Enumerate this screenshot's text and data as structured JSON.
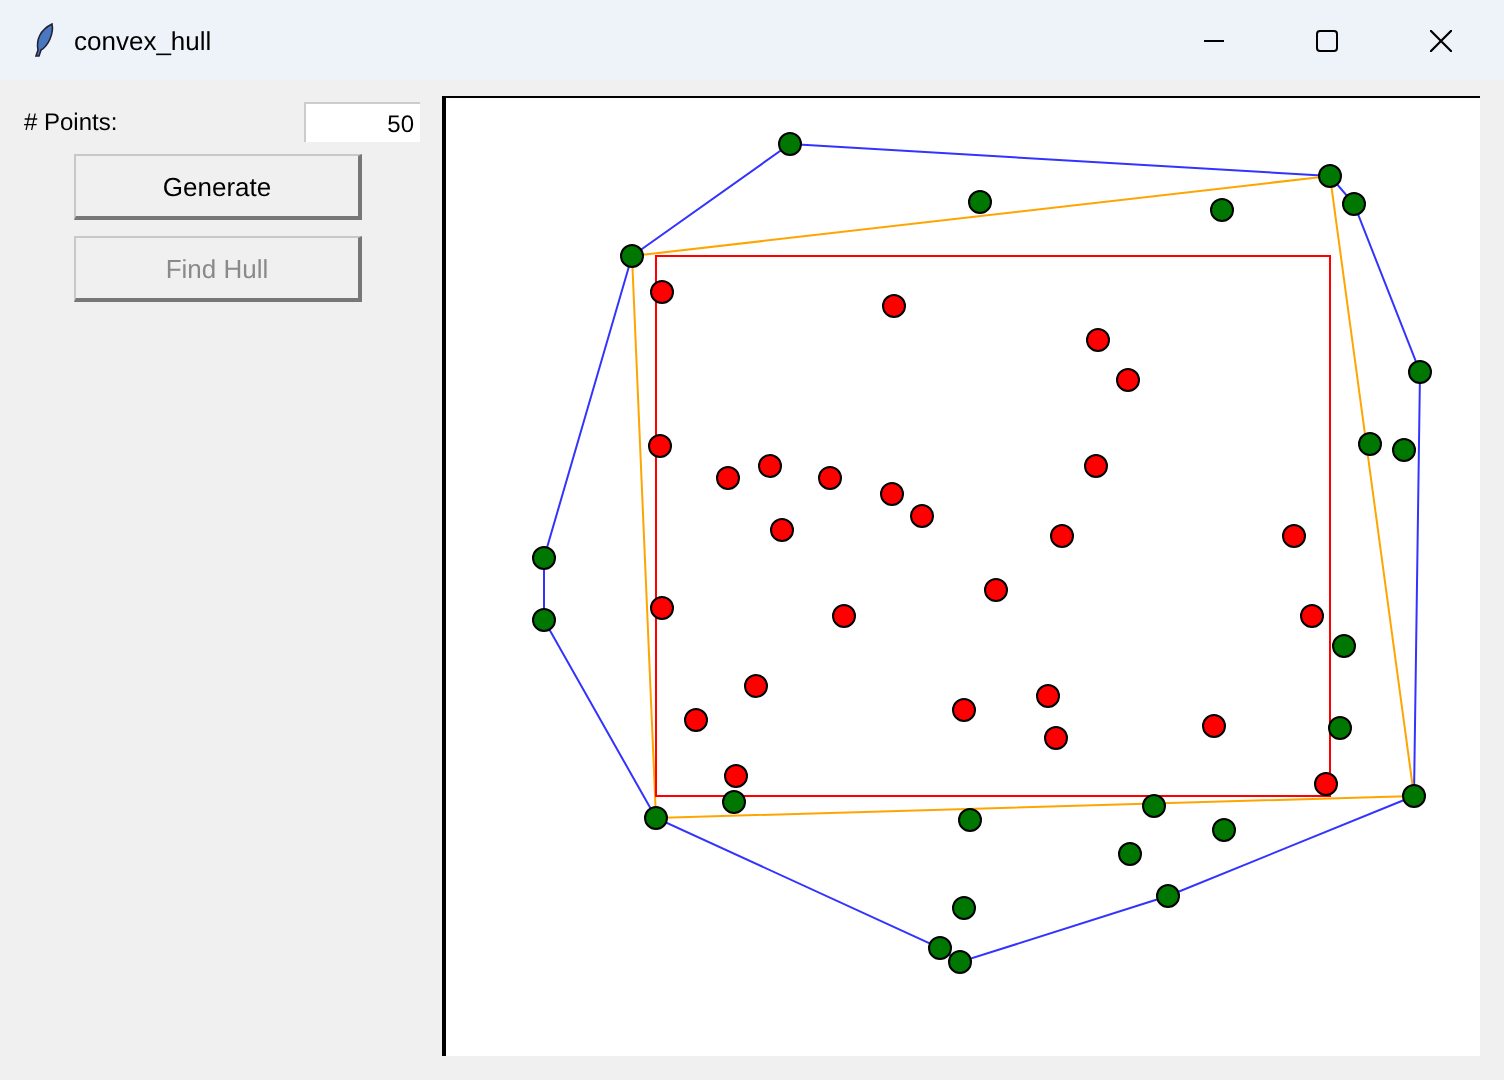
{
  "window": {
    "title": "convex_hull"
  },
  "points_field": {
    "label": "# Points:",
    "value": "50"
  },
  "buttons": [
    {
      "label": "Generate",
      "disabled": false
    },
    {
      "label": "Find Hull",
      "disabled": true
    }
  ]
}
